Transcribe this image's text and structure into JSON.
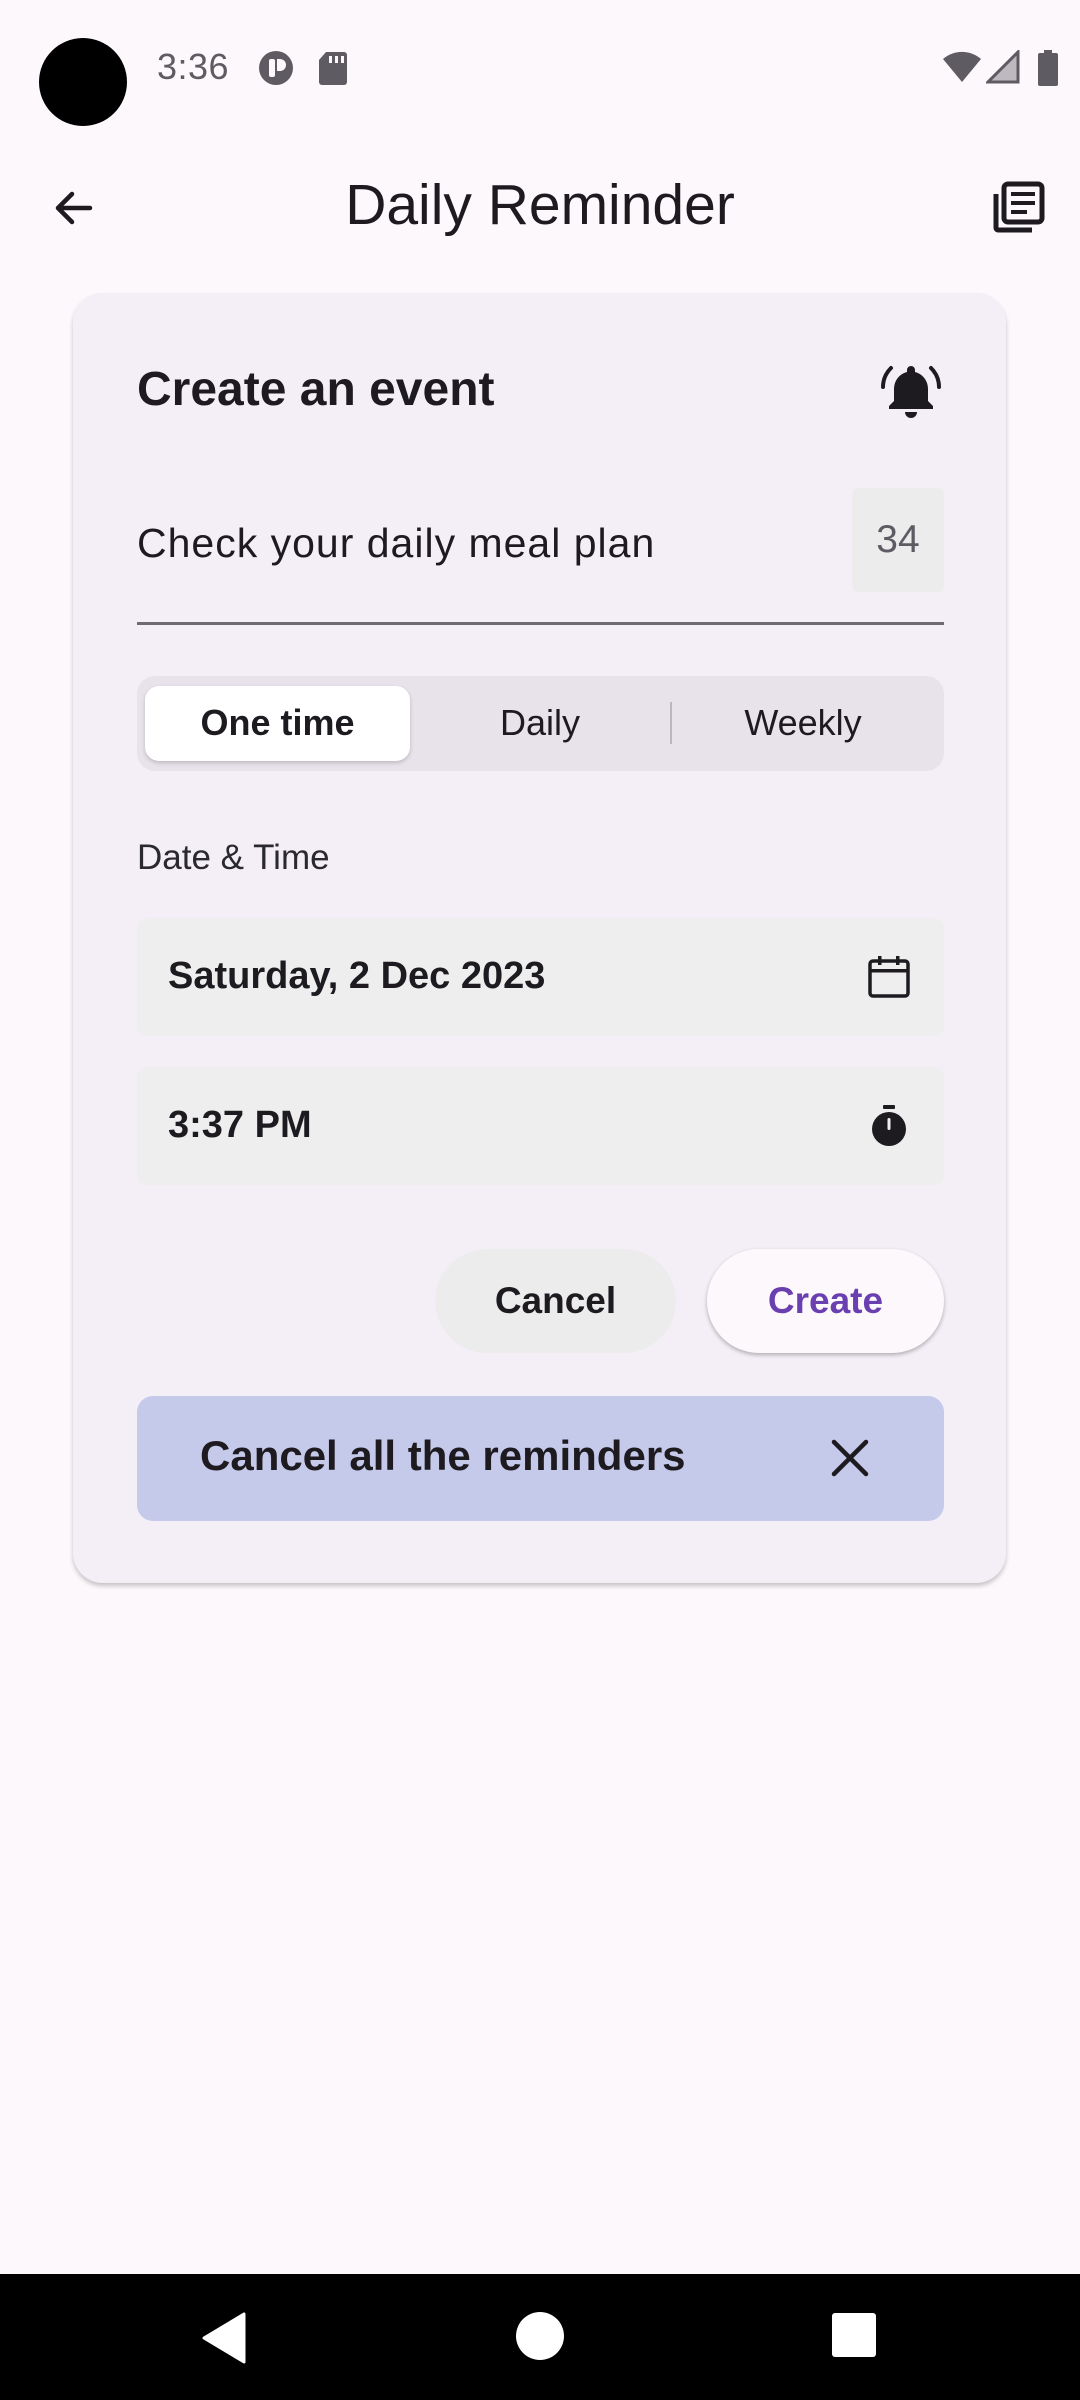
{
  "status_bar": {
    "time": "3:36",
    "icons": [
      "camera-dot",
      "app-notification-icon",
      "sd-card-icon",
      "wifi-icon",
      "signal-icon",
      "battery-icon"
    ]
  },
  "app_bar": {
    "title": "Daily Reminder",
    "back_icon": "arrow-back-icon",
    "action_icon": "library-books-icon"
  },
  "card": {
    "title": "Create an event",
    "title_icon": "bell-ringing-icon",
    "input_value": "Check your daily meal plan",
    "counter": "34",
    "segments": {
      "options": [
        "One time",
        "Daily",
        "Weekly"
      ],
      "selected": "One time"
    },
    "section_label": "Date & Time",
    "date_value": "Saturday, 2 Dec 2023",
    "date_icon": "calendar-icon",
    "time_value": "3:37 PM",
    "time_icon": "timer-icon",
    "cancel_label": "Cancel",
    "create_label": "Create",
    "cancel_all_label": "Cancel all the reminders",
    "cancel_all_icon": "close-icon"
  },
  "colors": {
    "background": "#fdf8fc",
    "card": "#f4eff7",
    "accent": "#6a3fb0",
    "cancel_all_bg": "#c5c9ea"
  },
  "nav_bar": {
    "icons": [
      "nav-back-icon",
      "nav-home-icon",
      "nav-recents-icon"
    ]
  }
}
